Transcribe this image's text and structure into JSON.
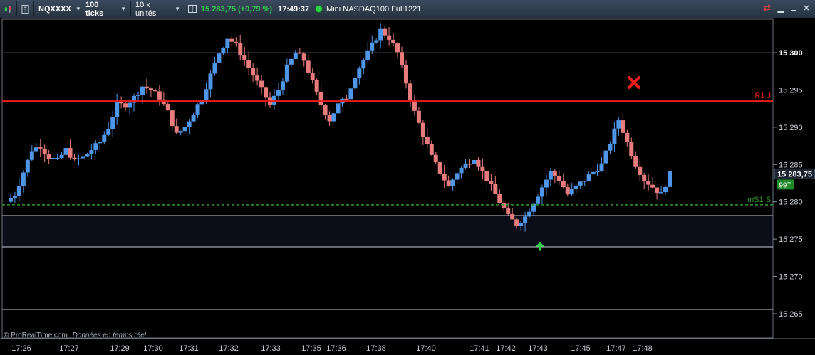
{
  "toolbar": {
    "symbol": "NQXXXX",
    "ticks": "100 ticks",
    "units": "10 k unités",
    "price_change": "15 283,75 (+0,79 %)",
    "time": "17:49:37",
    "instrument": "Mini NASDAQ100 Full1221"
  },
  "footer": {
    "copyright": "© ProRealTime.com",
    "realtime": "Données en temps réel"
  },
  "levels": {
    "r1_label": "R1 J",
    "ms1_label": "mS1 S",
    "current_price": "15 283,75",
    "badge": "99T"
  },
  "colors": {
    "up": "#4f95e8",
    "down": "#e87b7b",
    "r1": "#ee1c1c",
    "ms1": "#2d9c2d",
    "accent_green": "#2fd04b"
  },
  "chart_data": {
    "type": "candlestick",
    "ylim": [
      15262,
      15304
    ],
    "y_ticks": [
      "15 300",
      "15 295",
      "15 290",
      "15 285",
      "15 280",
      "15 275",
      "15 270",
      "15 265"
    ],
    "x_ticks": [
      "17:26",
      "17:27",
      "17:29",
      "17:30",
      "17:31",
      "17:32",
      "17:33",
      "17:35",
      "17:36",
      "17:38",
      "17:40",
      "17:41",
      "17:42",
      "17:43",
      "17:45",
      "17:47",
      "17:48"
    ],
    "horizontal_lines": [
      {
        "label": "R1 J",
        "value": 15293.5,
        "style": "solid"
      },
      {
        "label": "mS1 S",
        "value": 15279.6,
        "style": "dashed"
      }
    ],
    "path": [
      15280,
      15281,
      15284,
      15287,
      15287.5,
      15286,
      15285.5,
      15287,
      15285.5,
      15286,
      15287,
      15288,
      15290,
      15293,
      15293,
      15294,
      15295.5,
      15295,
      15294,
      15292,
      15289,
      15290,
      15292,
      15294,
      15297,
      15300,
      15302,
      15301,
      15299,
      15297,
      15295,
      15293,
      15295,
      15298,
      15300,
      15299,
      15296,
      15293,
      15291,
      15293,
      15294,
      15297,
      15299,
      15301,
      15303,
      15302,
      15300,
      15296,
      15292,
      15289,
      15286,
      15284,
      15282,
      15284,
      15285,
      15286,
      15284,
      15282,
      15280,
      15278,
      15277,
      15278,
      15280,
      15282,
      15284,
      15283,
      15281,
      15282,
      15283,
      15284,
      15285,
      15288,
      15291,
      15288,
      15285,
      15283,
      15282,
      15281,
      15283.75
    ],
    "markers": [
      {
        "type": "sell-cross",
        "value": 15296
      },
      {
        "type": "buy-arrow",
        "value": 15274
      }
    ]
  }
}
